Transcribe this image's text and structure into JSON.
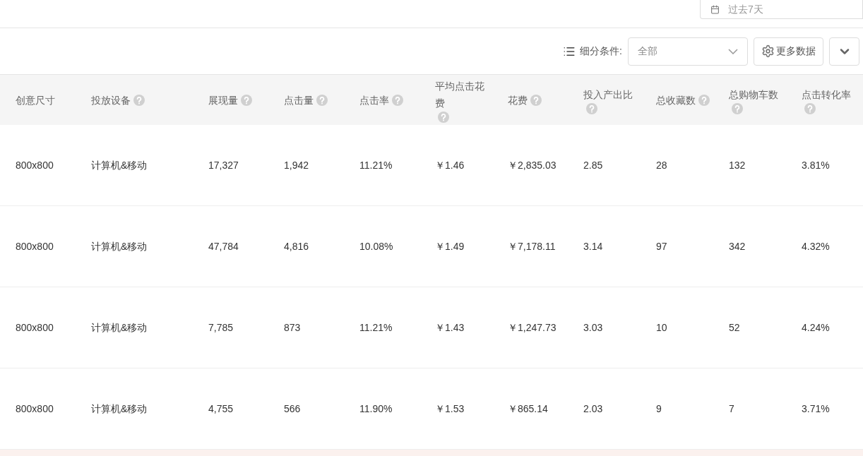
{
  "date_range": {
    "value": "过去7天"
  },
  "toolbar": {
    "segment_label": "细分条件:",
    "segment_select": {
      "value": "全部"
    },
    "more_data_button": "更多数据"
  },
  "table": {
    "columns": [
      {
        "label": "创意尺寸",
        "help": false
      },
      {
        "label": "投放设备",
        "help": true
      },
      {
        "label": "展现量",
        "help": true
      },
      {
        "label": "点击量",
        "help": true
      },
      {
        "label": "点击率",
        "help": true
      },
      {
        "label": "平均点击花费",
        "help": true
      },
      {
        "label": "花费",
        "help": true
      },
      {
        "label": "投入产出比",
        "help": true
      },
      {
        "label": "总收藏数",
        "help": true
      },
      {
        "label": "总购物车数",
        "help": true
      },
      {
        "label": "点击转化率",
        "help": true
      }
    ],
    "rows": [
      [
        "800x800",
        "计算机&移动",
        "17,327",
        "1,942",
        "11.21%",
        "￥1.46",
        "￥2,835.03",
        "2.85",
        "28",
        "132",
        "3.81%"
      ],
      [
        "800x800",
        "计算机&移动",
        "47,784",
        "4,816",
        "10.08%",
        "￥1.49",
        "￥7,178.11",
        "3.14",
        "97",
        "342",
        "4.32%"
      ],
      [
        "800x800",
        "计算机&移动",
        "7,785",
        "873",
        "11.21%",
        "￥1.43",
        "￥1,247.73",
        "3.03",
        "10",
        "52",
        "4.24%"
      ],
      [
        "800x800",
        "计算机&移动",
        "4,755",
        "566",
        "11.90%",
        "￥1.53",
        "￥865.14",
        "2.03",
        "9",
        "7",
        "3.71%"
      ]
    ]
  }
}
